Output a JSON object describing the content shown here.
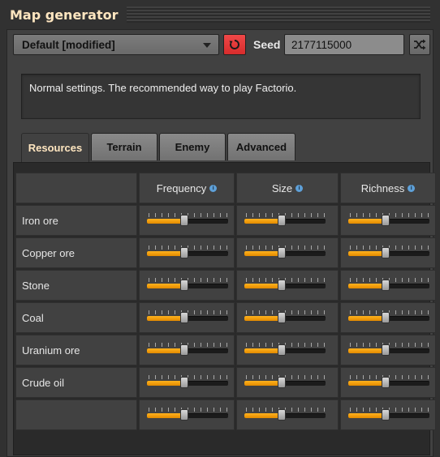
{
  "window": {
    "title": "Map generator"
  },
  "preset": {
    "selected": "Default [modified]"
  },
  "seed": {
    "label": "Seed",
    "value": "2177115000"
  },
  "description": "Normal settings. The recommended way to play Factorio.",
  "tabs": [
    {
      "label": "Resources",
      "active": true
    },
    {
      "label": "Terrain",
      "active": false
    },
    {
      "label": "Enemy",
      "active": false
    },
    {
      "label": "Advanced",
      "active": false
    }
  ],
  "columns": [
    "Frequency",
    "Size",
    "Richness"
  ],
  "rows": [
    {
      "label": "Iron ore",
      "values": [
        0.5,
        0.5,
        0.5
      ]
    },
    {
      "label": "Copper ore",
      "values": [
        0.5,
        0.5,
        0.5
      ]
    },
    {
      "label": "Stone",
      "values": [
        0.5,
        0.5,
        0.5
      ]
    },
    {
      "label": "Coal",
      "values": [
        0.5,
        0.5,
        0.5
      ]
    },
    {
      "label": "Uranium ore",
      "values": [
        0.5,
        0.5,
        0.5
      ]
    },
    {
      "label": "Crude oil",
      "values": [
        0.5,
        0.5,
        0.5
      ]
    },
    {
      "label": "",
      "values": [
        0.5,
        0.5,
        0.5
      ]
    }
  ],
  "colors": {
    "accent": "#f5a00f",
    "title": "#ffe6c0",
    "reset": "#e03a3a"
  },
  "icons": [
    "reset-icon",
    "shuffle-icon",
    "info-icon",
    "dropdown-caret-icon"
  ]
}
